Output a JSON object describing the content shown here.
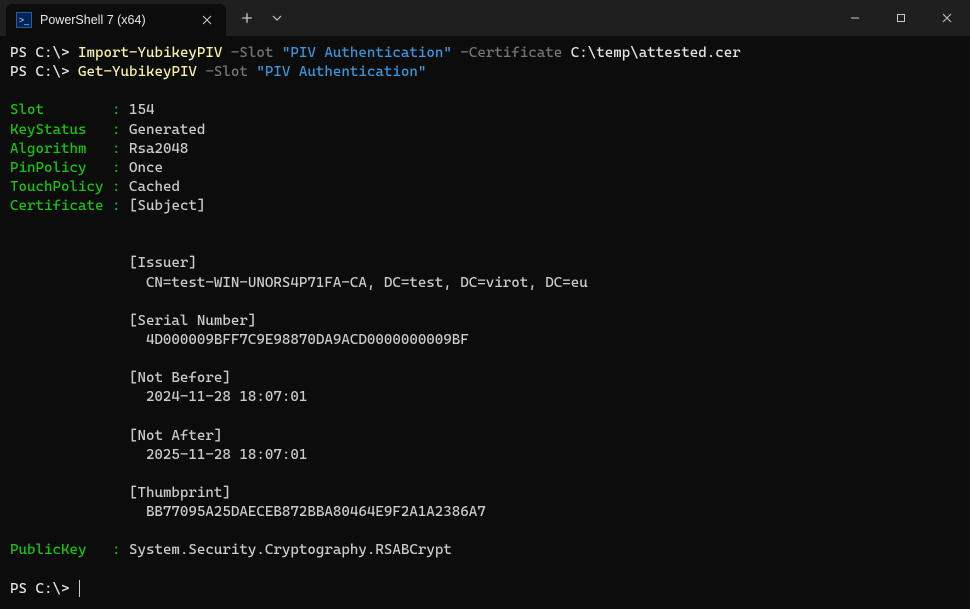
{
  "titlebar": {
    "tab_title": "PowerShell 7 (x64)",
    "tab_icon_text": ">_"
  },
  "terminal": {
    "prompt": "PS C:\\>",
    "cmd1": {
      "name": "Import-YubikeyPIV",
      "flag1": "-Slot",
      "arg1": "\"PIV Authentication\"",
      "flag2": "-Certificate",
      "arg2": "C:\\temp\\attested.cer"
    },
    "cmd2": {
      "name": "Get-YubikeyPIV",
      "flag1": "-Slot",
      "arg1": "\"PIV Authentication\""
    },
    "props": {
      "slot_label": "Slot",
      "slot_value": "154",
      "keystatus_label": "KeyStatus",
      "keystatus_value": "Generated",
      "algorithm_label": "Algorithm",
      "algorithm_value": "Rsa2048",
      "pinpolicy_label": "PinPolicy",
      "pinpolicy_value": "Once",
      "touchpolicy_label": "TouchPolicy",
      "touchpolicy_value": "Cached",
      "certificate_label": "Certificate",
      "subject_header": "[Subject]",
      "issuer_header": "[Issuer]",
      "issuer_value": "CN=test-WIN-UNORS4P71FA-CA, DC=test, DC=virot, DC=eu",
      "serial_header": "[Serial Number]",
      "serial_value": "4D000009BFF7C9E98870DA9ACD0000000009BF",
      "notbefore_header": "[Not Before]",
      "notbefore_value": "2024-11-28 18:07:01",
      "notafter_header": "[Not After]",
      "notafter_value": "2025-11-28 18:07:01",
      "thumbprint_header": "[Thumbprint]",
      "thumbprint_value": "BB77095A25DAECEB872BBA80464E9F2A1A2386A7",
      "publickey_label": "PublicKey",
      "publickey_value": "System.Security.Cryptography.RSABCrypt"
    }
  }
}
